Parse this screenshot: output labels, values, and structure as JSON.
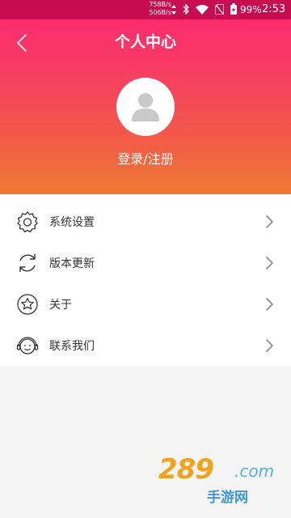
{
  "status_bar": {
    "net_speed_up": "758B/s",
    "net_speed_down": "506B/s",
    "battery_percent": "99%",
    "time": "2:53",
    "icons": [
      "arrows-icon",
      "bluetooth-icon",
      "wifi-icon",
      "no-sim-icon",
      "battery-charging-icon"
    ]
  },
  "header": {
    "title": "个人中心",
    "back_icon": "chevron-left-icon",
    "avatar_icon": "user-silhouette-icon",
    "login_label": "登录/注册",
    "gradient_top": "#fb2d6d",
    "gradient_bottom": "#ef7a34"
  },
  "menu": {
    "items": [
      {
        "label": "系统设置",
        "icon": "gear-icon"
      },
      {
        "label": "版本更新",
        "icon": "refresh-icon"
      },
      {
        "label": "关于",
        "icon": "star-icon"
      },
      {
        "label": "联系我们",
        "icon": "headset-icon"
      }
    ]
  },
  "watermark": {
    "brand": "289",
    "domain": ".com",
    "caption": "手游网"
  }
}
